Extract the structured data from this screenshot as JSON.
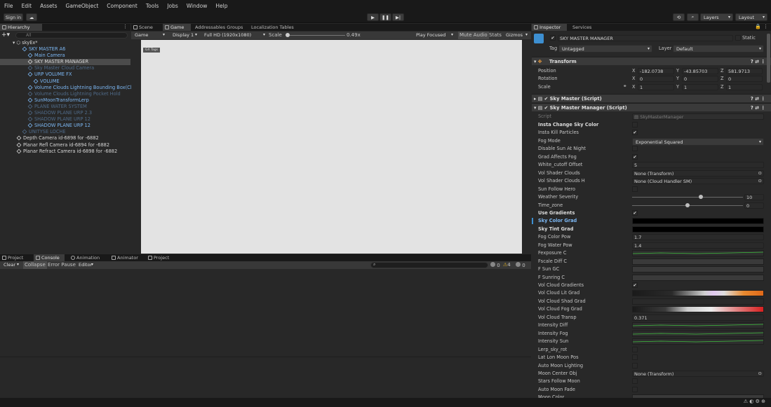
{
  "menu": [
    "File",
    "Edit",
    "Assets",
    "GameObject",
    "Component",
    "Tools",
    "Jobs",
    "Window",
    "Help"
  ],
  "toolbar": {
    "sign_in": "Sign in",
    "layers": "Layers",
    "layout": "Layout"
  },
  "hierarchy": {
    "tab": "Hierarchy",
    "search_placeholder": "All",
    "scene": "skyEx*",
    "items": [
      {
        "label": "SKY MASTER A6",
        "indent": 0,
        "cls": "blue"
      },
      {
        "label": "Main Camera",
        "indent": 1,
        "cls": "blue"
      },
      {
        "label": "SKY MASTER MANAGER",
        "indent": 1,
        "cls": "white sel"
      },
      {
        "label": "Sky Master Cloud Camera",
        "indent": 1,
        "cls": "dim"
      },
      {
        "label": "URP VOLUME FX",
        "indent": 1,
        "cls": "blue"
      },
      {
        "label": "VOLUME",
        "indent": 2,
        "cls": "blue"
      },
      {
        "label": "Volume Clouds Lightning Bounding Box(Clone)",
        "indent": 1,
        "cls": "blue"
      },
      {
        "label": "Volume Clouds Lightning Pocket Hold",
        "indent": 1,
        "cls": "dim"
      },
      {
        "label": "SunMoonTransformLerp",
        "indent": 1,
        "cls": "blue"
      },
      {
        "label": "PLANE WATER SYSTEM",
        "indent": 1,
        "cls": "dim"
      },
      {
        "label": "SHADOW PLANE URP 2.3",
        "indent": 1,
        "cls": "dim"
      },
      {
        "label": "SHADOW PLANE URP 12",
        "indent": 1,
        "cls": "dim"
      },
      {
        "label": "SHADOW PLANE URP 12",
        "indent": 1,
        "cls": "blue"
      },
      {
        "label": "UNITYSE LOCHE",
        "indent": 0,
        "cls": "dim"
      },
      {
        "label": "Depth Camera id-6898 for -6882",
        "indent": -1,
        "cls": "white"
      },
      {
        "label": "Planar Refl Camera id-6894 for -6882",
        "indent": -1,
        "cls": "white"
      },
      {
        "label": "Planar Refract Camera id-6898 for -6882",
        "indent": -1,
        "cls": "white"
      }
    ]
  },
  "game": {
    "tabs": [
      "Scene",
      "Game",
      "Addressables Groups",
      "Localization Tables"
    ],
    "display": "Game",
    "display_num": "Display 1",
    "resolution": "Full HD (1920x1080)",
    "scale_label": "Scale",
    "scale_value": "0.49x",
    "play_focused": "Play Focused",
    "mute": "Mute Audio",
    "stats": "Stats",
    "gizmos": "Gizmos",
    "overlay_tag": "GX Tags"
  },
  "console": {
    "tabs": [
      "Project",
      "Console",
      "Animation",
      "Animator",
      "Project"
    ],
    "clear": "Clear",
    "collapse": "Collapse",
    "error_pause": "Error Pause",
    "editor": "Editor",
    "count_info": "0",
    "count_warn": "4",
    "count_err": "0"
  },
  "inspector": {
    "tabs": [
      "Inspector",
      "Services"
    ],
    "object_name": "SKY MASTER MANAGER",
    "static": "Static",
    "tag_label": "Tag",
    "tag": "Untagged",
    "layer_label": "Layer",
    "layer": "Default",
    "transform": {
      "title": "Transform",
      "position": "Position",
      "rotation": "Rotation",
      "scale": "Scale",
      "px": "-182.0738",
      "py": "-43.85703",
      "pz": "581.9713",
      "rx": "0",
      "ry": "0",
      "rz": "0",
      "sx": "1",
      "sy": "1",
      "sz": "1"
    },
    "comp1": "Sky Master (Script)",
    "comp2": "Sky Master Manager (Script)",
    "script_label": "Script",
    "script_value": "SkyMasterManager",
    "props": [
      {
        "label": "Insta Change Sky Color",
        "type": "chk",
        "val": "",
        "style": "b"
      },
      {
        "label": "Insta Kill Particles",
        "type": "chk",
        "val": "✔",
        "style": ""
      },
      {
        "label": "Fog Mode",
        "type": "dd",
        "val": "Exponential Squared",
        "style": ""
      },
      {
        "label": "Disable Sun At Night",
        "type": "chk",
        "val": "",
        "style": ""
      },
      {
        "label": "Grad Affects Fog",
        "type": "chk",
        "val": "✔",
        "style": ""
      },
      {
        "label": "White_cutoff Offset",
        "type": "field",
        "val": "5",
        "style": ""
      },
      {
        "label": "Vol Shader Clouds",
        "type": "obj",
        "val": "None (Transform)",
        "style": ""
      },
      {
        "label": "Vol Shader Clouds H",
        "type": "obj",
        "val": "None (Cloud Handler SM)",
        "style": ""
      },
      {
        "label": "Sun Follow Hero",
        "type": "chk",
        "val": "",
        "style": ""
      },
      {
        "label": "Weather Severity",
        "type": "slider",
        "val": "10",
        "style": "",
        "pos": 0.62
      },
      {
        "label": "Time_zone",
        "type": "slider",
        "val": "0",
        "style": "",
        "pos": 0.5
      },
      {
        "label": "Use Gradients",
        "type": "chk",
        "val": "✔",
        "style": "b"
      },
      {
        "label": "Sky Color Grad",
        "type": "black",
        "val": "",
        "style": "hl"
      },
      {
        "label": "Sky Tint Grad",
        "type": "black",
        "val": "",
        "style": "b"
      },
      {
        "label": "Fog Color Pow",
        "type": "field",
        "val": "1.7",
        "style": ""
      },
      {
        "label": "Fog Water Pow",
        "type": "field",
        "val": "1.4",
        "style": ""
      },
      {
        "label": "Fexposure C",
        "type": "curve",
        "val": "",
        "style": ""
      },
      {
        "label": "Fscale Diff C",
        "type": "blank",
        "val": "",
        "style": ""
      },
      {
        "label": "F Sun GC",
        "type": "blank",
        "val": "",
        "style": ""
      },
      {
        "label": "F Sunring C",
        "type": "blank",
        "val": "",
        "style": ""
      },
      {
        "label": "Vol Cloud Gradients",
        "type": "chk",
        "val": "✔",
        "style": ""
      },
      {
        "label": "Vol Cloud Lit Grad",
        "type": "grad1",
        "val": "",
        "style": ""
      },
      {
        "label": "Vol Cloud Shad Grad",
        "type": "grad2",
        "val": "",
        "style": ""
      },
      {
        "label": "Vol Cloud Fog Grad",
        "type": "grad3",
        "val": "",
        "style": ""
      },
      {
        "label": "Vol Cloud Transp",
        "type": "field",
        "val": "0.371",
        "style": ""
      },
      {
        "label": "Intensity Diff",
        "type": "curve",
        "val": "",
        "style": ""
      },
      {
        "label": "Intensity Fog",
        "type": "curve",
        "val": "",
        "style": ""
      },
      {
        "label": "Intensity Sun",
        "type": "curve",
        "val": "",
        "style": ""
      },
      {
        "label": "Lerp_sky_rot",
        "type": "chk",
        "val": "",
        "style": ""
      },
      {
        "label": "Lat Lon Moon Pos",
        "type": "chk",
        "val": "",
        "style": ""
      },
      {
        "label": "Auto Moon Lighting",
        "type": "chk",
        "val": "",
        "style": ""
      },
      {
        "label": "Moon Center Obj",
        "type": "obj",
        "val": "None (Transform)",
        "style": ""
      },
      {
        "label": "Stars Follow Moon",
        "type": "chk",
        "val": "",
        "style": ""
      },
      {
        "label": "Auto Moon Fade",
        "type": "chk",
        "val": "",
        "style": ""
      },
      {
        "label": "Moon Color",
        "type": "blank",
        "val": "",
        "style": ""
      }
    ]
  }
}
